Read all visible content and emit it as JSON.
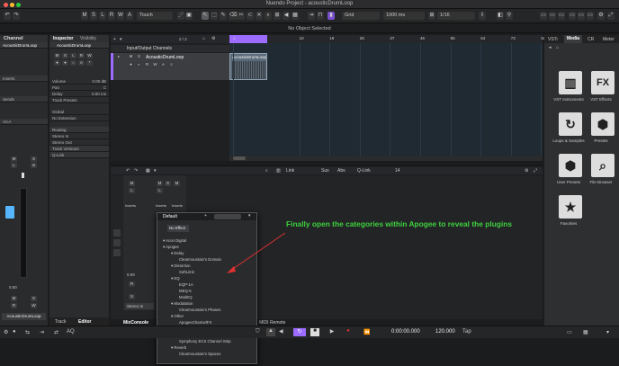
{
  "window": {
    "title": "Nuendo Project - acousticDrumLoop"
  },
  "toolbar": {
    "mode_buttons": [
      "M",
      "S",
      "L",
      "R",
      "W",
      "A"
    ],
    "touch": "Touch",
    "grid": "Grid",
    "grid_value": "1000 ms",
    "quantize": "1/16"
  },
  "info_line": "No Object Selected",
  "channel_panel": {
    "tab": "Channel",
    "track_name": "AcousticDrumLoop",
    "sections": [
      "Inserts",
      "Sends",
      "VCA"
    ],
    "value_pan": "0.00",
    "track_label": "AcousticDrumLoop"
  },
  "inspector": {
    "tabs": [
      "Inspector",
      "Visibility"
    ],
    "track_name": "AcousticDrumLoop",
    "rows": [
      "Volume",
      "Pan",
      "Delay",
      "Track Presets",
      "Global",
      "No Extension"
    ],
    "volume_value": "0.00 dB",
    "pan_value": "C",
    "delay_value": "0.00 ms",
    "sections": [
      "Routing",
      "Stereo In",
      "Stereo Out",
      "Track Versions",
      "Q-Link"
    ],
    "bottom_tabs": [
      "Track",
      "Editor"
    ]
  },
  "tracklist": {
    "header_label": "Input/Output Channels",
    "track": "AcousticDrumLoop",
    "count": "2 / 2"
  },
  "timeline": {
    "marks": [
      "1",
      "10",
      "19",
      "28",
      "37",
      "46",
      "55",
      "64",
      "73",
      "82"
    ],
    "clip": "AcousticDrumLoop"
  },
  "lower_zone": {
    "toolbar": [
      "Link",
      "Sus",
      "Abs",
      "Q-Link"
    ],
    "value": "14",
    "tabs": [
      "MixConsole",
      "MIDI Remote"
    ],
    "inserts_labels": [
      "Inserts",
      "Inserts",
      "Inserts"
    ],
    "channel": "Stereo In",
    "value2": "0.00"
  },
  "insert_menu": {
    "header": "Default",
    "no_effect": "No Effect",
    "items": [
      {
        "label": "Acon Digital",
        "level": 0
      },
      {
        "label": "Apogee",
        "level": 0
      },
      {
        "label": "Delay",
        "level": 1
      },
      {
        "label": "Clearmountain's Domain",
        "level": 2
      },
      {
        "label": "Distortion",
        "level": 1
      },
      {
        "label": "SoftLimit",
        "level": 2
      },
      {
        "label": "EQ",
        "level": 1
      },
      {
        "label": "EQP-1A",
        "level": 2
      },
      {
        "label": "MEQ-5",
        "level": 2
      },
      {
        "label": "ModEQ",
        "level": 2
      },
      {
        "label": "Modulation",
        "level": 1
      },
      {
        "label": "Clearmountain's Phases",
        "level": 2
      },
      {
        "label": "Other",
        "level": 1
      },
      {
        "label": "ApogeeChannelFX",
        "level": 2
      },
      {
        "label": "ModComp",
        "level": 2
      },
      {
        "label": "Opto-3A",
        "level": 2
      },
      {
        "label": "Symphony ECS Channel Strip",
        "level": 2
      },
      {
        "label": "Reverb",
        "level": 1
      },
      {
        "label": "Clearmountain's Spaces",
        "level": 2
      }
    ]
  },
  "annotation": "Finally open the categories within Apogee to reveal the plugins",
  "right_zone": {
    "tabs": [
      "VSTi",
      "Media",
      "CR",
      "Meter"
    ],
    "tiles": [
      {
        "icon": "piano-icon",
        "glyph": "▥",
        "label": "VST Instruments"
      },
      {
        "icon": "fx-icon",
        "glyph": "FX",
        "label": "VST Effects"
      },
      {
        "icon": "loop-icon",
        "glyph": "↻",
        "label": "Loops & Samples"
      },
      {
        "icon": "presets-icon",
        "glyph": "⬢",
        "label": "Presets"
      },
      {
        "icon": "user-presets-icon",
        "glyph": "⬢",
        "label": "User Presets"
      },
      {
        "icon": "file-browser-icon",
        "glyph": "⌕",
        "label": "File Browser"
      },
      {
        "icon": "favorites-icon",
        "glyph": "★",
        "label": "Favorites"
      }
    ]
  },
  "transport": {
    "time": "0:00:00.000",
    "tempo": "120.000",
    "tap": "Tap"
  },
  "colors": {
    "accent": "#9b6cff",
    "annotation": "#3ed13e",
    "arrow": "#e03030"
  }
}
